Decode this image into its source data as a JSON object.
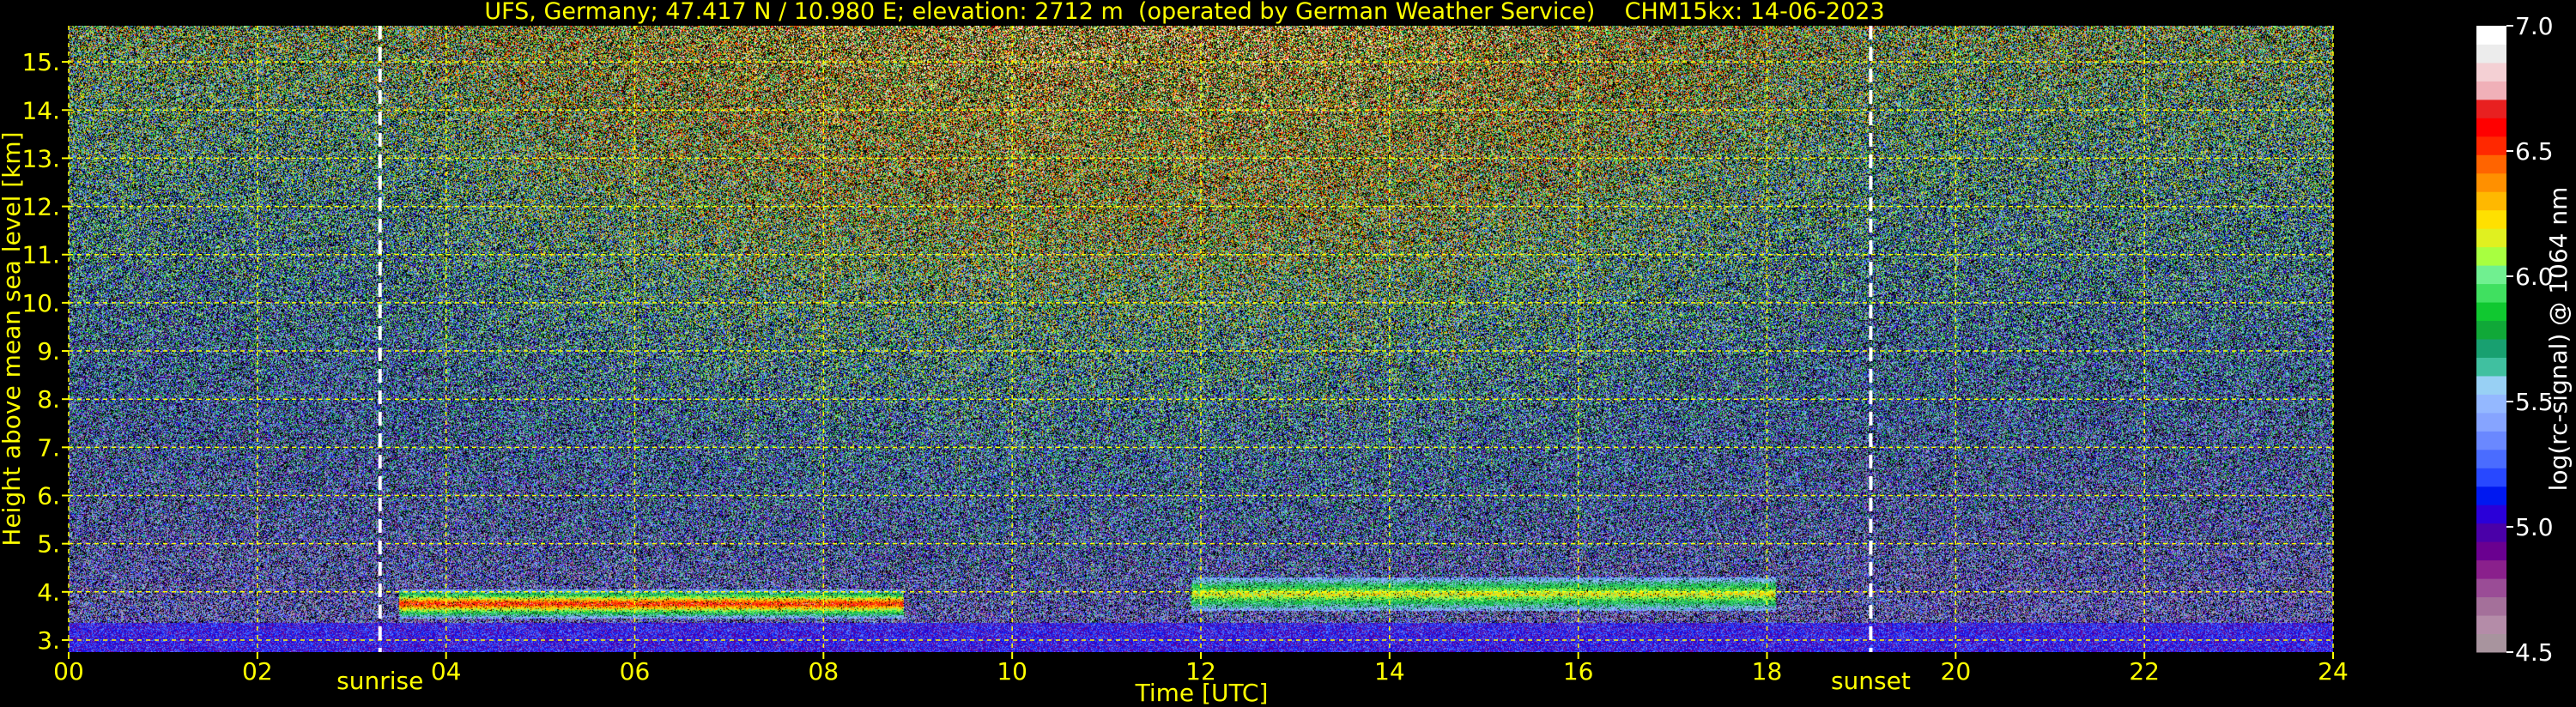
{
  "chart_data": {
    "type": "heatmap",
    "title": "UFS, Germany; 47.417 N / 10.980 E; elevation: 2712 m  (operated by German Weather Service)    CHM15kx: 14-06-2023",
    "xlabel": "Time [UTC]",
    "ylabel": "Height above mean sea level [km]",
    "xlim": [
      0,
      24
    ],
    "ylim": [
      2.75,
      15.75
    ],
    "x_ticks": [
      "00",
      "02",
      "04",
      "06",
      "08",
      "10",
      "12",
      "14",
      "16",
      "18",
      "20",
      "22",
      "24"
    ],
    "y_ticks": [
      "3.",
      "4.",
      "5.",
      "6.",
      "7.",
      "8.",
      "9.",
      "10.",
      "11.",
      "12.",
      "13.",
      "14.",
      "15."
    ],
    "grid": true,
    "events": [
      {
        "label": "sunrise",
        "time": 3.3
      },
      {
        "label": "sunset",
        "time": 19.1
      }
    ],
    "colorbar": {
      "label": "log(rc-signal) @ 1064 nm",
      "min": 4.5,
      "max": 7.0,
      "ticks": [
        "4.5",
        "5.0",
        "5.5",
        "6.0",
        "6.5",
        "7.0"
      ],
      "colors": [
        "#a8949e",
        "#b48ca8",
        "#a4709a",
        "#9a4c96",
        "#8a208c",
        "#6a0090",
        "#4a00a8",
        "#2a00d8",
        "#0018f0",
        "#2848ff",
        "#4a6cff",
        "#6a88ff",
        "#86a4ff",
        "#94b8ff",
        "#98d0f4",
        "#40c0a0",
        "#18a070",
        "#10a838",
        "#10c830",
        "#40e060",
        "#70f090",
        "#a8ff40",
        "#e0f020",
        "#ffe000",
        "#ffb800",
        "#ff9000",
        "#ff6400",
        "#ff2800",
        "#ff0000",
        "#e82020",
        "#f0b0b8",
        "#f4d0d4",
        "#ececec",
        "#ffffff"
      ]
    },
    "features": [
      {
        "name": "cloud-layer",
        "t0": 3.5,
        "t1": 8.85,
        "base_km": 3.45,
        "top_km": 4.05,
        "peak": 6.6
      },
      {
        "name": "cloud-layer",
        "t0": 11.9,
        "t1": 18.1,
        "base_km": 3.6,
        "top_km": 4.3,
        "peak": 6.2
      },
      {
        "name": "boundary-layer",
        "t0": 0,
        "t1": 24,
        "base_km": 2.75,
        "top_km": 3.4,
        "peak": 5.3
      }
    ]
  },
  "colors": {
    "text": "#ffff00",
    "grid": "#ffff00",
    "event_line": "#ffffff",
    "colorbar_text": "#ffffff"
  }
}
